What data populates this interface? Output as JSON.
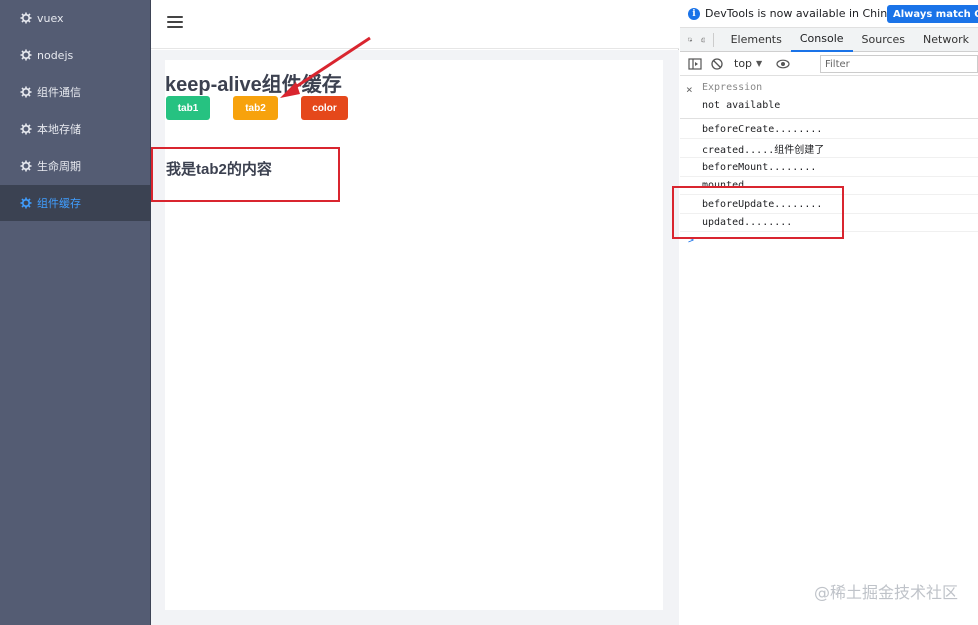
{
  "sidebar": {
    "items": [
      {
        "label": "vuex",
        "active": false
      },
      {
        "label": "nodejs",
        "active": false
      },
      {
        "label": "组件通信",
        "active": false
      },
      {
        "label": "本地存储",
        "active": false
      },
      {
        "label": "生命周期",
        "active": false
      },
      {
        "label": "组件缓存",
        "active": true
      }
    ],
    "colors": {
      "background": "#545c73",
      "active_text": "#409eff"
    }
  },
  "main": {
    "title": "keep-alive组件缓存",
    "buttons": [
      {
        "label": "tab1",
        "color": "#26c281"
      },
      {
        "label": "tab2",
        "color": "#f7a20c"
      },
      {
        "label": "color",
        "color": "#e5481b"
      }
    ],
    "content": "我是tab2的内容"
  },
  "devtools": {
    "info_text": "DevTools is now available in Chinese!",
    "info_button": "Always match Chr",
    "tabs": [
      "Elements",
      "Console",
      "Sources",
      "Network"
    ],
    "active_tab": "Console",
    "context": "top",
    "filter_placeholder": "Filter",
    "expression_label": "Expression",
    "expression_value": "not available",
    "logs": [
      "beforeCreate........",
      "created.....组件创建了",
      "beforeMount........",
      "mounted........",
      "beforeUpdate........",
      "updated........"
    ],
    "prompt": ">"
  },
  "watermark": "@稀土掘金技术社区"
}
